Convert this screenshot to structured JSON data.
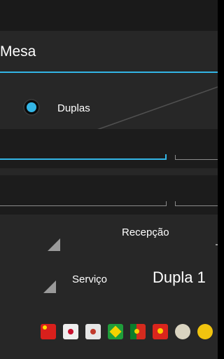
{
  "dialog": {
    "title": "Mesa",
    "radio_option_label": "Duplas",
    "receive_label": "Recepção",
    "serve_label": "Serviço",
    "serve_value": "Dupla 1"
  },
  "colors": {
    "accent": "#33b5e5",
    "background": "#272727",
    "field_row": "#1c1c1c"
  },
  "flags": [
    "china-flag",
    "japan-flag",
    "korea-flag",
    "brazil-flag",
    "portugal-flag",
    "vietnam-flag",
    "round-flag",
    "yellow-flag"
  ]
}
